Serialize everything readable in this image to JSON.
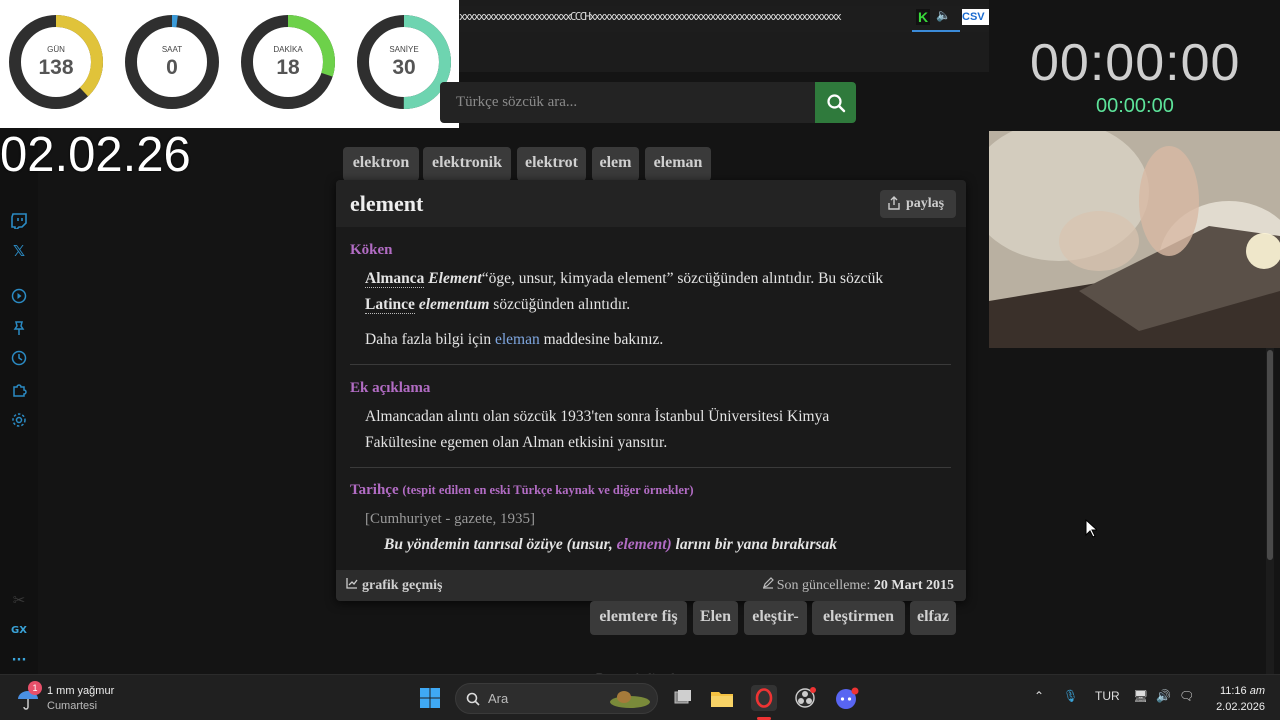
{
  "countdown": {
    "dials": [
      {
        "label": "GÜN",
        "value": "138",
        "fraction": 0.38,
        "color": "#e0c33a"
      },
      {
        "label": "SAAT",
        "value": "0",
        "fraction": 0.02,
        "color": "#3a9ad8"
      },
      {
        "label": "DAKİKA",
        "value": "18",
        "fraction": 0.3,
        "color": "#6dd14a"
      },
      {
        "label": "SANİYE",
        "value": "30",
        "fraction": 0.5,
        "color": "#6ed4b0"
      }
    ],
    "date_overlay": "02.02.26"
  },
  "browser": {
    "tab_text": "xxxxxxxxxxxxxxxxxxxxxxxCCCHxxxxxxxxxxxxxxxxxxxxxxxxxxxxxxxxxxxxxxxxxxxxxxxxxxxx",
    "tab_active_letter": "K",
    "tab_right_text": "CSV"
  },
  "search": {
    "placeholder": "Türkçe sözcük ara..."
  },
  "chips_top": [
    "elektron",
    "elektronik",
    "elektrot",
    "elem",
    "eleman"
  ],
  "chips_bottom": [
    "elemtere fiş",
    "Elen",
    "eleştir-",
    "eleştirmen",
    "elfaz"
  ],
  "entry": {
    "word": "element",
    "share_label": "paylaş",
    "sections": {
      "origin_title": "Köken",
      "origin_lang1": "Almanca",
      "origin_word1": "Element",
      "origin_text1": "“öge, unsur, kimyada element” sözcüğünden alıntıdır. Bu sözcük",
      "origin_lang2": "Latince",
      "origin_word2": "elementum",
      "origin_text2": "sözcüğünden alıntıdır.",
      "more_pre": "Daha fazla bilgi için",
      "more_link": "eleman",
      "more_post": "maddesine bakınız.",
      "note_title": "Ek açıklama",
      "note_line1": "Almancadan alıntı olan sözcük 1933'ten sonra İstanbul Üniversitesi Kimya",
      "note_line2": "Fakültesine egemen olan Alman etkisini yansıtır.",
      "history_title": "Tarihçe",
      "history_sub": "(tespit edilen en eski Türkçe kaynak ve diğer örnekler)",
      "history_cite": "[Cumhuriyet - gazete, 1935]",
      "quote_pre": "Bu yöndemin tanrısal özüye (unsur,",
      "quote_hl": "element)",
      "quote_post": "larını bir yana bırakırsak"
    },
    "footer_left": "grafik geçmiş",
    "footer_right_label": "Son güncelleme:",
    "footer_right_date": "20 Mart 2015"
  },
  "timers": {
    "big": "00:00:00",
    "small": "00:00:00"
  },
  "sidebar": {
    "gx_label": "GX",
    "more_label": "···"
  },
  "footnote": "Benzer kelimeler",
  "taskbar": {
    "weather_badge": "1",
    "weather_line1": "1 mm yağmur",
    "weather_line2": "Cumartesi",
    "search_label": "Ara",
    "lang": "TUR",
    "time": "11:16",
    "ampm": "am",
    "date": "2.02.2026"
  }
}
